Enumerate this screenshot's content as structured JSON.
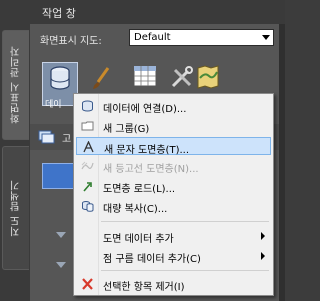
{
  "side_tabs": {
    "display_manager": "화면표시 관리자",
    "map_explorer": "지도 탐색기"
  },
  "panel": {
    "title": "작업 창",
    "display_order_label": "화면표시 지도:",
    "display_order_value": "Default",
    "data_button_label": "데이",
    "tree_header_text": "고"
  },
  "menu": {
    "items": [
      {
        "label": "데이터에 연결(D)...",
        "icon": "database-connect-icon",
        "enabled": true
      },
      {
        "label": "새 그룹(G)",
        "icon": "folder-icon",
        "enabled": true
      },
      {
        "label": "새 문자 도면층(T)...",
        "icon": "text-layer-icon",
        "enabled": true,
        "highlighted": true
      },
      {
        "label": "새 등고선 도면층(N)...",
        "icon": "contour-layer-icon",
        "enabled": false
      },
      {
        "label": "도면층 로드(L)...",
        "icon": "layer-load-icon",
        "enabled": true
      },
      {
        "label": "대량 복사(C)...",
        "icon": "bulk-copy-icon",
        "enabled": true
      },
      {
        "label": "도면 데이터 추가",
        "icon": "",
        "enabled": true,
        "submenu": true
      },
      {
        "label": "점 구름 데이터 추가(C)",
        "icon": "",
        "enabled": true,
        "submenu": true
      },
      {
        "label": "선택한 항목 제거(I)",
        "icon": "remove-icon",
        "enabled": true
      }
    ]
  },
  "colors": {
    "highlight": "#cde3fb",
    "highlight_border": "#7eb4ea",
    "remove_red": "#d83a2c"
  }
}
